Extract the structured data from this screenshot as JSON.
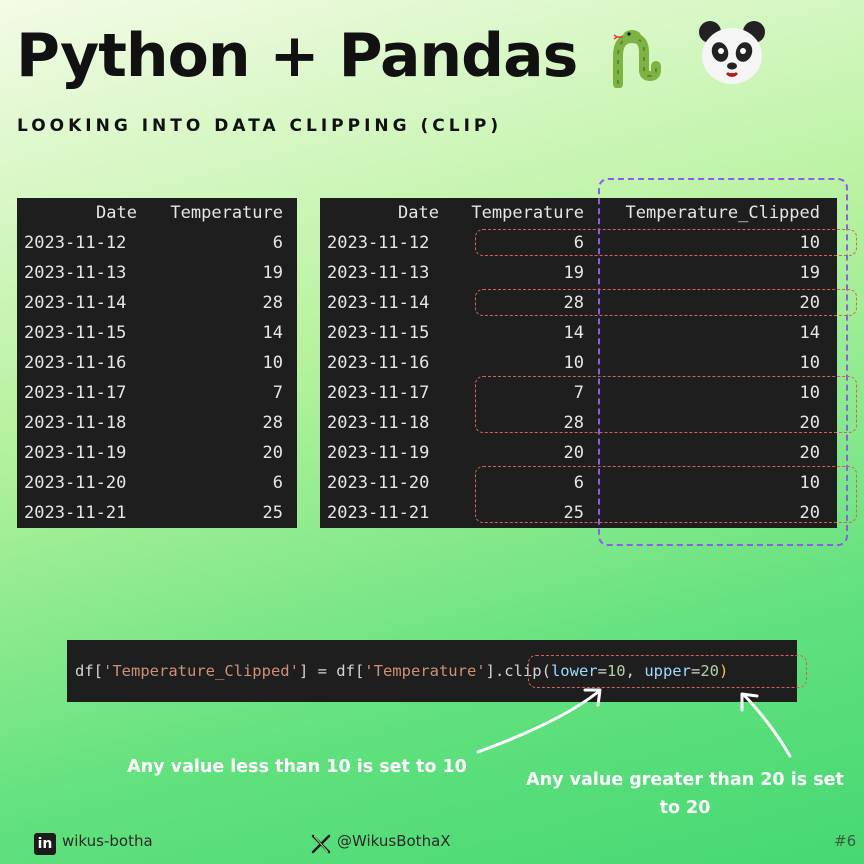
{
  "title": "Python + Pandas",
  "subtitle": "LOOKING INTO DATA CLIPPING (CLIP)",
  "icons": [
    "snake-icon",
    "panda-icon"
  ],
  "colors": {
    "table_bg": "#1e1e1e",
    "clipped_highlight": "#8a5cf0",
    "changed_highlight": "#d0645c",
    "note_text": "#ffffff"
  },
  "table_original": {
    "headers": [
      "Date",
      "Temperature"
    ],
    "rows": [
      [
        "2023-11-12",
        "6"
      ],
      [
        "2023-11-13",
        "19"
      ],
      [
        "2023-11-14",
        "28"
      ],
      [
        "2023-11-15",
        "14"
      ],
      [
        "2023-11-16",
        "10"
      ],
      [
        "2023-11-17",
        "7"
      ],
      [
        "2023-11-18",
        "28"
      ],
      [
        "2023-11-19",
        "20"
      ],
      [
        "2023-11-20",
        "6"
      ],
      [
        "2023-11-21",
        "25"
      ]
    ]
  },
  "table_clipped": {
    "headers": [
      "Date",
      "Temperature",
      "Temperature_Clipped"
    ],
    "rows": [
      [
        "2023-11-12",
        "6",
        "10"
      ],
      [
        "2023-11-13",
        "19",
        "19"
      ],
      [
        "2023-11-14",
        "28",
        "20"
      ],
      [
        "2023-11-15",
        "14",
        "14"
      ],
      [
        "2023-11-16",
        "10",
        "10"
      ],
      [
        "2023-11-17",
        "7",
        "10"
      ],
      [
        "2023-11-18",
        "28",
        "20"
      ],
      [
        "2023-11-19",
        "20",
        "20"
      ],
      [
        "2023-11-20",
        "6",
        "10"
      ],
      [
        "2023-11-21",
        "25",
        "20"
      ]
    ]
  },
  "code": {
    "p1": "df[",
    "s1": "'Temperature_Clipped'",
    "p2": "] = df[",
    "s2": "'Temperature'",
    "p3": "].clip(",
    "k1": "lower",
    "eq1": "=",
    "n1": "10",
    "comma": ", ",
    "k2": "upper",
    "eq2": "=",
    "n2": "20",
    "close": ")"
  },
  "notes": {
    "lower": "Any value less than 10 is set to 10",
    "upper_line1": "Any value greater than 20 is set",
    "upper_line2": "to 20"
  },
  "footer": {
    "linkedin_icon_text": "in",
    "linkedin": "wikus-botha",
    "x_handle": "@WikusBothaX",
    "page": "#6"
  }
}
